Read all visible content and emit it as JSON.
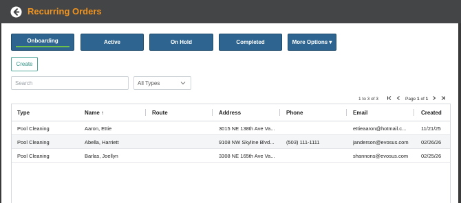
{
  "header": {
    "title": "Recurring Orders"
  },
  "tabs": [
    {
      "label": "Onboarding"
    },
    {
      "label": "Active"
    },
    {
      "label": "On Hold"
    },
    {
      "label": "Completed"
    },
    {
      "label": "More Options ▾"
    }
  ],
  "actions": {
    "create_label": "Create"
  },
  "filters": {
    "search_placeholder": "Search",
    "type_value": "All Types"
  },
  "pager": {
    "range": "1 to 3 of 3",
    "page_label": "Page",
    "page_current": "1",
    "page_of": "of",
    "page_total": "1"
  },
  "table": {
    "columns": [
      "Type",
      "Name ↑",
      "Route",
      "Address",
      "Phone",
      "Email",
      "Created"
    ],
    "rows": [
      {
        "type": "Pool Cleaning",
        "name": "Aaron, Ettie",
        "route": "",
        "address": "3015 NE 138th Ave Va...",
        "phone": "",
        "email": "ettieaaron@hotmail.c...",
        "created": "11/21/25"
      },
      {
        "type": "Pool Cleaning",
        "name": "Abella, Harriett",
        "route": "",
        "address": "9108 NW Skyline Blvd...",
        "phone": "(503) 111-1111",
        "email": "janderson@evosus.com",
        "created": "02/26/26"
      },
      {
        "type": "Pool Cleaning",
        "name": "Barlas, Joellyn",
        "route": "",
        "address": "3308 NE 165th Ave Va...",
        "phone": "",
        "email": "shannons@evosus.com",
        "created": "02/25/26"
      }
    ]
  }
}
